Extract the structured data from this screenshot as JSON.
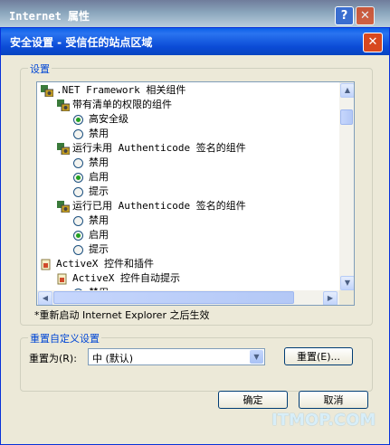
{
  "outer_window": {
    "title": "Internet 属性",
    "help_label": "?",
    "close_label": "✕"
  },
  "dialog": {
    "title": "安全设置 - 受信任的站点区域",
    "close_label": "✕",
    "settings_group": {
      "legend": "设置",
      "items": [
        {
          "type": "category",
          "icon": "settings-gear-icon",
          "text": ".NET Framework 相关组件"
        },
        {
          "type": "category",
          "icon": "settings-gear-icon",
          "text": "带有清单的权限的组件"
        },
        {
          "type": "option",
          "text": "高安全级",
          "checked": true
        },
        {
          "type": "option",
          "text": "禁用",
          "checked": false
        },
        {
          "type": "category",
          "icon": "settings-gear-icon",
          "text": "运行未用 Authenticode 签名的组件"
        },
        {
          "type": "option",
          "text": "禁用",
          "checked": false
        },
        {
          "type": "option",
          "text": "启用",
          "checked": true
        },
        {
          "type": "option",
          "text": "提示",
          "checked": false
        },
        {
          "type": "category",
          "icon": "settings-gear-icon",
          "text": "运行已用 Authenticode 签名的组件"
        },
        {
          "type": "option",
          "text": "禁用",
          "checked": false
        },
        {
          "type": "option",
          "text": "启用",
          "checked": true
        },
        {
          "type": "option",
          "text": "提示",
          "checked": false
        },
        {
          "type": "category",
          "icon": "activex-icon",
          "text": "ActiveX 控件和插件"
        },
        {
          "type": "category",
          "icon": "activex-icon",
          "text": "ActiveX 控件自动提示"
        },
        {
          "type": "option",
          "text": "禁用",
          "checked": false
        }
      ],
      "note": "*重新启动 Internet Explorer 之后生效"
    },
    "reset_group": {
      "legend": "重置自定义设置",
      "reset_to_label": "重置为(R):",
      "reset_select_value": "中 (默认)",
      "reset_button": "重置(E)..."
    },
    "ok_button": "确定",
    "cancel_button": "取消"
  },
  "watermark": "ITMOP.COM",
  "colors": {
    "title_blue": "#0a5fe8",
    "legend_blue": "#0046d5",
    "close_red": "#d8481f",
    "radio_green": "#21a121"
  }
}
